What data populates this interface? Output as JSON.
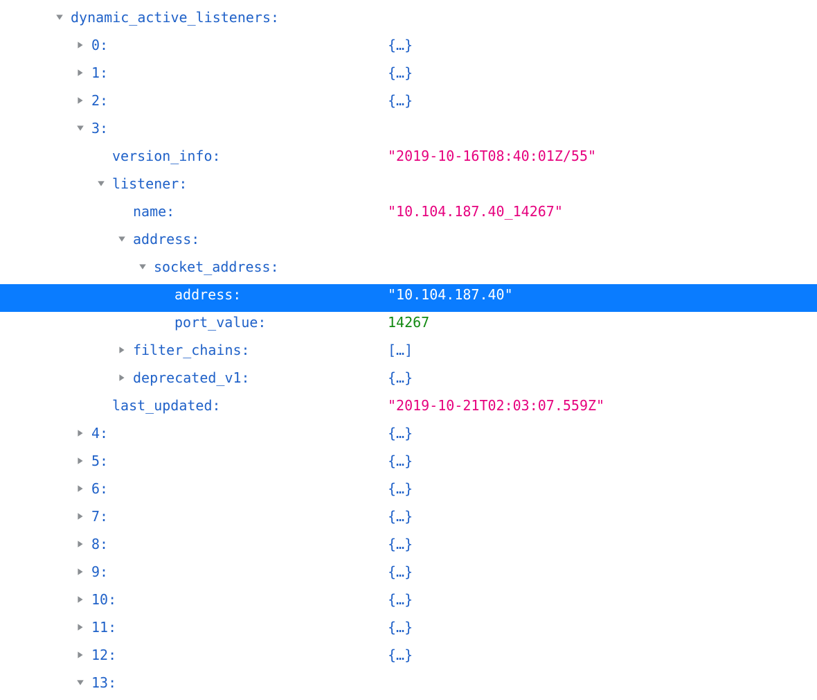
{
  "root_key": "dynamic_active_listeners:",
  "collapsed_placeholder_obj": "{…}",
  "collapsed_placeholder_arr": "[…]",
  "items": {
    "0": "0:",
    "1": "1:",
    "2": "2:",
    "3": "3:",
    "4": "4:",
    "5": "5:",
    "6": "6:",
    "7": "7:",
    "8": "8:",
    "9": "9:",
    "10": "10:",
    "11": "11:",
    "12": "12:",
    "13": "13:"
  },
  "item3": {
    "version_info_key": "version_info:",
    "version_info_val": "\"2019-10-16T08:40:01Z/55\"",
    "listener_key": "listener:",
    "listener": {
      "name_key": "name:",
      "name_val": "\"10.104.187.40_14267\"",
      "address_key": "address:",
      "socket_address_key": "socket_address:",
      "socket_address": {
        "address_key": "address:",
        "address_val": "\"10.104.187.40\"",
        "port_value_key": "port_value:",
        "port_value_val": "14267"
      },
      "filter_chains_key": "filter_chains:",
      "deprecated_v1_key": "deprecated_v1:"
    },
    "last_updated_key": "last_updated:",
    "last_updated_val": "\"2019-10-21T02:03:07.559Z\""
  }
}
